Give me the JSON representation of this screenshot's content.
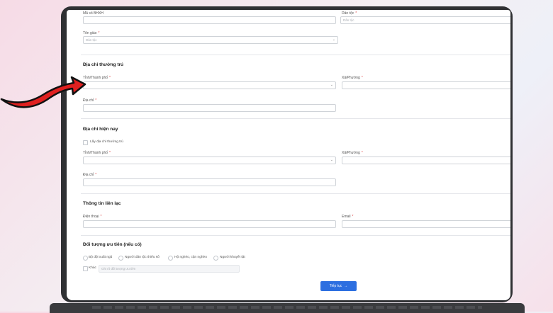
{
  "form": {
    "fields": {
      "ma_so_bhxh": {
        "label": "Mã số BHXH"
      },
      "dan_toc": {
        "label": "Dân tộc",
        "placeholder": "Dân tộc"
      },
      "ton_giao": {
        "label": "Tôn giáo",
        "placeholder": "Dân tộc"
      }
    },
    "thuong_tru": {
      "title": "Địa chỉ thường trú",
      "tinh_label": "Tỉnh/Thành phố",
      "xa_label": "Xã/Phường",
      "dia_chi_label": "Địa chỉ"
    },
    "hien_nay": {
      "title": "Địa chỉ hiện nay",
      "same_checkbox_label": "Lấy địa chỉ thường trú",
      "tinh_label": "Tỉnh/Thành phố",
      "xa_label": "Xã/Phường",
      "dia_chi_label": "Địa chỉ"
    },
    "lien_lac": {
      "title": "Thông tin liên lạc",
      "phone_label": "Điện thoại",
      "email_label": "Email"
    },
    "uu_tien": {
      "title": "Đối tượng ưu tiên (nếu có)",
      "options": [
        "Bộ đội xuất ngũ",
        "Người dân tộc thiểu số",
        "Hộ nghèo, cận nghèo",
        "Người khuyết tật"
      ],
      "other_label": "Khác",
      "other_placeholder": "Ghi rõ đối tượng ưu tiên"
    },
    "required_mark": "*",
    "submit_label": "Tiếp tục",
    "submit_arrow": "→",
    "chevron": "⌄"
  },
  "colors": {
    "primary": "#2d6fe0",
    "required": "#e04848",
    "arrow": "#e02020"
  }
}
